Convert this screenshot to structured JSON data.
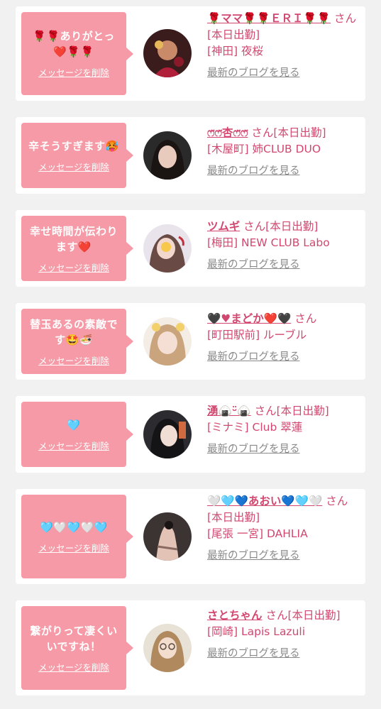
{
  "delete_label": "メッセージを削除",
  "blog_label": "最新のブログを見る",
  "colors": {
    "bubble": "#f59aa6",
    "accent": "#d2476f",
    "link_gray": "#8a8a8a",
    "background": "#f1f1f1"
  },
  "items": [
    {
      "message": "🌹🌹ありがとっ❤️🌹🌹",
      "name": "🌹ママ🌹🌹ＥＲＩ🌹🌹",
      "suffix": "さん[本日出勤]",
      "shop": "[神田] 夜桜"
    },
    {
      "message": "辛そうすぎます🥵",
      "name": "ෆ̈ෆ̈杏ෆ̈ෆ̈",
      "suffix": "さん[本日出勤]",
      "shop": "[木屋町] 姉CLUB DUO"
    },
    {
      "message": "幸せ時間が伝わります❤️",
      "name": "ツムギ",
      "suffix": "さん[本日出勤]",
      "shop": "[梅田] NEW CLUB Labo"
    },
    {
      "message": "替玉あるの素敵です🤩🍜",
      "name": "🖤♥まどか❤️🖤",
      "suffix": "さん",
      "shop": "[町田駅前] ルーブル"
    },
    {
      "message": "🩵",
      "name": "湧🍙ᵕ̈🍙",
      "suffix": "さん[本日出勤]",
      "shop": "[ミナミ] Club 翠蓮"
    },
    {
      "message": "🩵🤍🩵🤍🩵",
      "name": "🤍🩵💙あおい💙🩵🤍",
      "suffix": "さん[本日出勤]",
      "shop": "[尾張 一宮] DAHLIA"
    },
    {
      "message": "繋がりって凄くいいですね！",
      "name": "さとちゃん",
      "suffix": "さん[本日出勤]",
      "shop": "[岡崎] Lapis Lazuli"
    }
  ]
}
